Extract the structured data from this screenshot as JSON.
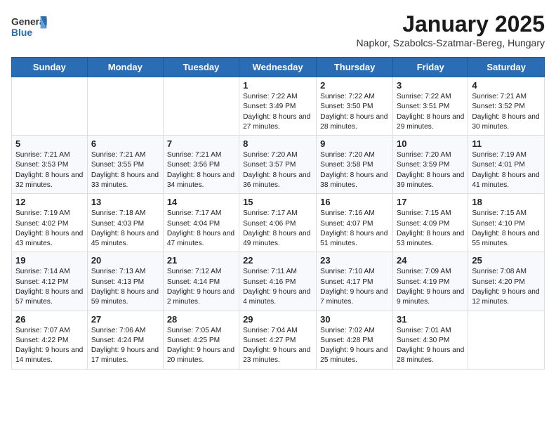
{
  "header": {
    "logo_general": "General",
    "logo_blue": "Blue",
    "title": "January 2025",
    "subtitle": "Napkor, Szabolcs-Szatmar-Bereg, Hungary"
  },
  "days_of_week": [
    "Sunday",
    "Monday",
    "Tuesday",
    "Wednesday",
    "Thursday",
    "Friday",
    "Saturday"
  ],
  "weeks": [
    [
      {
        "day": "",
        "info": ""
      },
      {
        "day": "",
        "info": ""
      },
      {
        "day": "",
        "info": ""
      },
      {
        "day": "1",
        "info": "Sunrise: 7:22 AM\nSunset: 3:49 PM\nDaylight: 8 hours and 27 minutes."
      },
      {
        "day": "2",
        "info": "Sunrise: 7:22 AM\nSunset: 3:50 PM\nDaylight: 8 hours and 28 minutes."
      },
      {
        "day": "3",
        "info": "Sunrise: 7:22 AM\nSunset: 3:51 PM\nDaylight: 8 hours and 29 minutes."
      },
      {
        "day": "4",
        "info": "Sunrise: 7:21 AM\nSunset: 3:52 PM\nDaylight: 8 hours and 30 minutes."
      }
    ],
    [
      {
        "day": "5",
        "info": "Sunrise: 7:21 AM\nSunset: 3:53 PM\nDaylight: 8 hours and 32 minutes."
      },
      {
        "day": "6",
        "info": "Sunrise: 7:21 AM\nSunset: 3:55 PM\nDaylight: 8 hours and 33 minutes."
      },
      {
        "day": "7",
        "info": "Sunrise: 7:21 AM\nSunset: 3:56 PM\nDaylight: 8 hours and 34 minutes."
      },
      {
        "day": "8",
        "info": "Sunrise: 7:20 AM\nSunset: 3:57 PM\nDaylight: 8 hours and 36 minutes."
      },
      {
        "day": "9",
        "info": "Sunrise: 7:20 AM\nSunset: 3:58 PM\nDaylight: 8 hours and 38 minutes."
      },
      {
        "day": "10",
        "info": "Sunrise: 7:20 AM\nSunset: 3:59 PM\nDaylight: 8 hours and 39 minutes."
      },
      {
        "day": "11",
        "info": "Sunrise: 7:19 AM\nSunset: 4:01 PM\nDaylight: 8 hours and 41 minutes."
      }
    ],
    [
      {
        "day": "12",
        "info": "Sunrise: 7:19 AM\nSunset: 4:02 PM\nDaylight: 8 hours and 43 minutes."
      },
      {
        "day": "13",
        "info": "Sunrise: 7:18 AM\nSunset: 4:03 PM\nDaylight: 8 hours and 45 minutes."
      },
      {
        "day": "14",
        "info": "Sunrise: 7:17 AM\nSunset: 4:04 PM\nDaylight: 8 hours and 47 minutes."
      },
      {
        "day": "15",
        "info": "Sunrise: 7:17 AM\nSunset: 4:06 PM\nDaylight: 8 hours and 49 minutes."
      },
      {
        "day": "16",
        "info": "Sunrise: 7:16 AM\nSunset: 4:07 PM\nDaylight: 8 hours and 51 minutes."
      },
      {
        "day": "17",
        "info": "Sunrise: 7:15 AM\nSunset: 4:09 PM\nDaylight: 8 hours and 53 minutes."
      },
      {
        "day": "18",
        "info": "Sunrise: 7:15 AM\nSunset: 4:10 PM\nDaylight: 8 hours and 55 minutes."
      }
    ],
    [
      {
        "day": "19",
        "info": "Sunrise: 7:14 AM\nSunset: 4:12 PM\nDaylight: 8 hours and 57 minutes."
      },
      {
        "day": "20",
        "info": "Sunrise: 7:13 AM\nSunset: 4:13 PM\nDaylight: 8 hours and 59 minutes."
      },
      {
        "day": "21",
        "info": "Sunrise: 7:12 AM\nSunset: 4:14 PM\nDaylight: 9 hours and 2 minutes."
      },
      {
        "day": "22",
        "info": "Sunrise: 7:11 AM\nSunset: 4:16 PM\nDaylight: 9 hours and 4 minutes."
      },
      {
        "day": "23",
        "info": "Sunrise: 7:10 AM\nSunset: 4:17 PM\nDaylight: 9 hours and 7 minutes."
      },
      {
        "day": "24",
        "info": "Sunrise: 7:09 AM\nSunset: 4:19 PM\nDaylight: 9 hours and 9 minutes."
      },
      {
        "day": "25",
        "info": "Sunrise: 7:08 AM\nSunset: 4:20 PM\nDaylight: 9 hours and 12 minutes."
      }
    ],
    [
      {
        "day": "26",
        "info": "Sunrise: 7:07 AM\nSunset: 4:22 PM\nDaylight: 9 hours and 14 minutes."
      },
      {
        "day": "27",
        "info": "Sunrise: 7:06 AM\nSunset: 4:24 PM\nDaylight: 9 hours and 17 minutes."
      },
      {
        "day": "28",
        "info": "Sunrise: 7:05 AM\nSunset: 4:25 PM\nDaylight: 9 hours and 20 minutes."
      },
      {
        "day": "29",
        "info": "Sunrise: 7:04 AM\nSunset: 4:27 PM\nDaylight: 9 hours and 23 minutes."
      },
      {
        "day": "30",
        "info": "Sunrise: 7:02 AM\nSunset: 4:28 PM\nDaylight: 9 hours and 25 minutes."
      },
      {
        "day": "31",
        "info": "Sunrise: 7:01 AM\nSunset: 4:30 PM\nDaylight: 9 hours and 28 minutes."
      },
      {
        "day": "",
        "info": ""
      }
    ]
  ]
}
